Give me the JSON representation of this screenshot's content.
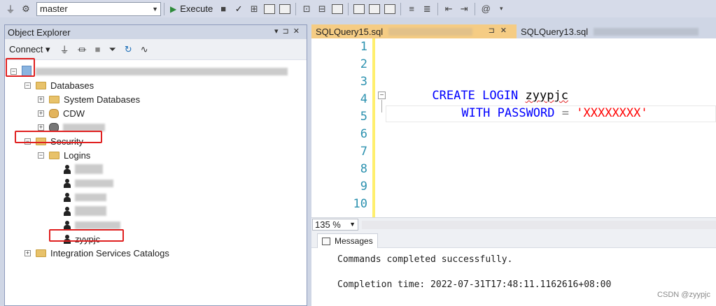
{
  "toolbar": {
    "database": "master",
    "execute_label": "Execute"
  },
  "object_explorer": {
    "title": "Object Explorer",
    "connect_label": "Connect",
    "tree": {
      "databases": "Databases",
      "system_databases": "System Databases",
      "cdw": "CDW",
      "security": "Security",
      "logins": "Logins",
      "new_login": "zyypjc",
      "integration_services": "Integration Services Catalogs"
    }
  },
  "editor": {
    "tabs": [
      {
        "label": "SQLQuery15.sql"
      },
      {
        "label": "SQLQuery13.sql"
      }
    ],
    "line_numbers": [
      "1",
      "2",
      "3",
      "4",
      "5",
      "6",
      "7",
      "8",
      "9",
      "10"
    ],
    "code": {
      "create": "CREATE",
      "login": "LOGIN",
      "name": "zyypjc",
      "with": "WITH",
      "password": "PASSWORD",
      "eq": "=",
      "pwd_value": "'XXXXXXXX'"
    },
    "zoom": "135 %"
  },
  "results": {
    "tab_label": "Messages",
    "message": "Commands completed successfully.",
    "completion": "Completion time: 2022-07-31T17:48:11.1162616+08:00"
  },
  "watermark": "CSDN @zyypjc",
  "colors": {
    "active_tab": "#f5cc84",
    "keyword": "#0000ff",
    "string": "#ff0000",
    "line_number": "#2b91af",
    "highlight_box": "#e02020"
  }
}
